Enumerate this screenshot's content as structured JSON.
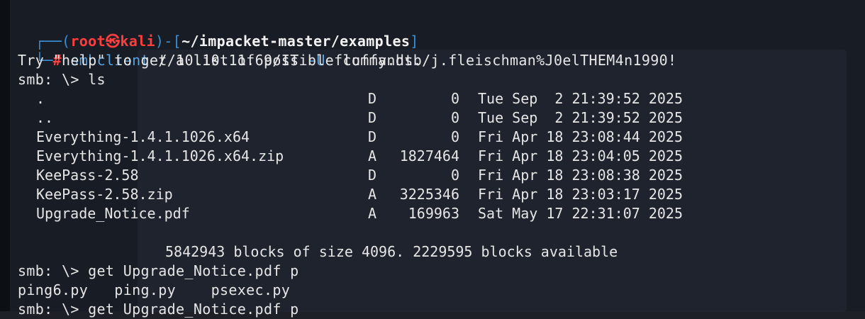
{
  "prompt": {
    "open": "┌──(",
    "user": "root",
    "skull": "㉿",
    "host": "kali",
    "mid": ")-[",
    "path": "~/impacket-master/examples",
    "close": "]",
    "line2_prefix": "└─",
    "hash": "#"
  },
  "command": {
    "name": "smbclient",
    "target": " //10.10.11.69/IT ",
    "flag": "-U",
    "creds": " fluffy.htb/j.fleischman%J0elTHEM4n1990!"
  },
  "help_line": "Try \"help\" to get a list of possible commands.",
  "ls_prompt": "smb: \\> ls",
  "listing": [
    {
      "name": ".",
      "attr": "D",
      "size": "0",
      "date": "Tue Sep  2 21:39:52 2025"
    },
    {
      "name": "..",
      "attr": "D",
      "size": "0",
      "date": "Tue Sep  2 21:39:52 2025"
    },
    {
      "name": "Everything-1.4.1.1026.x64",
      "attr": "D",
      "size": "0",
      "date": "Fri Apr 18 23:08:44 2025"
    },
    {
      "name": "Everything-1.4.1.1026.x64.zip",
      "attr": "A",
      "size": "1827464",
      "date": "Fri Apr 18 23:04:05 2025"
    },
    {
      "name": "KeePass-2.58",
      "attr": "D",
      "size": "0",
      "date": "Fri Apr 18 23:08:38 2025"
    },
    {
      "name": "KeePass-2.58.zip",
      "attr": "A",
      "size": "3225346",
      "date": "Fri Apr 18 23:03:17 2025"
    },
    {
      "name": "Upgrade_Notice.pdf",
      "attr": "A",
      "size": "169963",
      "date": "Sat May 17 22:31:07 2025"
    }
  ],
  "blocks_line": "5842943 blocks of size 4096. 2229595 blocks available",
  "get_line": "smb: \\> get Upgrade_Notice.pdf p",
  "completion_line": "ping6.py   ping.py    psexec.py",
  "get_line_2": "smb: \\> get Upgrade_Notice.pdf p",
  "colors": {
    "prompt_blue": "#3a8fd4",
    "prompt_red": "#ff3e3e",
    "text": "#e6e6e6",
    "background": "#181c24"
  }
}
